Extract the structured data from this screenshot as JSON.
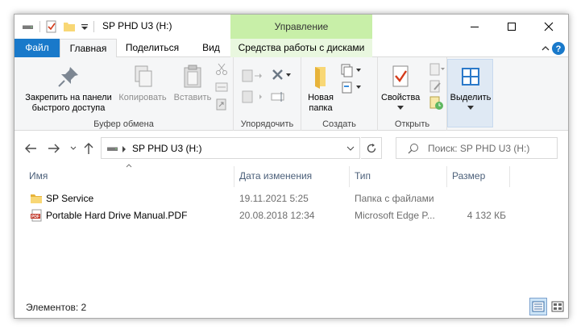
{
  "window": {
    "title": "SP PHD U3 (H:)",
    "context_group": "Управление"
  },
  "tabs": [
    {
      "label": "Файл"
    },
    {
      "label": "Главная"
    },
    {
      "label": "Поделиться"
    },
    {
      "label": "Вид"
    },
    {
      "label": "Средства работы с дисками"
    }
  ],
  "ribbon": {
    "clipboard": {
      "pin_label_1": "Закрепить на панели",
      "pin_label_2": "быстрого доступа",
      "copy_label": "Копировать",
      "paste_label": "Вставить",
      "group_label": "Буфер обмена"
    },
    "organize": {
      "group_label": "Упорядочить"
    },
    "create": {
      "new_folder_1": "Новая",
      "new_folder_2": "папка",
      "group_label": "Создать"
    },
    "open": {
      "properties_label": "Свойства",
      "group_label": "Открыть"
    },
    "select": {
      "select_label": "Выделить"
    }
  },
  "address": {
    "path": "SP PHD U3 (H:)",
    "search_placeholder": "Поиск: SP PHD U3 (H:)"
  },
  "columns": {
    "name": "Имя",
    "date": "Дата изменения",
    "type": "Тип",
    "size": "Размер"
  },
  "files": [
    {
      "name": "SP Service",
      "date": "19.11.2021 5:25",
      "type": "Папка с файлами",
      "size": "",
      "icon": "folder-icon"
    },
    {
      "name": "Portable Hard Drive Manual.PDF",
      "date": "20.08.2018 12:34",
      "type": "Microsoft Edge P...",
      "size": "4 132 КБ",
      "icon": "pdf-icon"
    }
  ],
  "status": {
    "items_count": "Элементов: 2"
  },
  "colors": {
    "accent": "#1979ca",
    "context_tab": "#c8efa8",
    "folder": "#f8d775",
    "header_text": "#4c607a"
  }
}
